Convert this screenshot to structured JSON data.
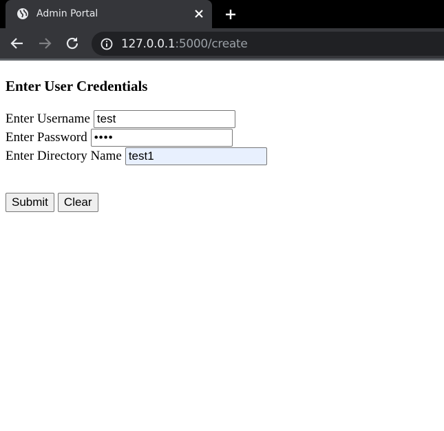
{
  "browser": {
    "tab_title": "Admin Portal",
    "url_host": "127.0.0.1",
    "url_path": ":5000/create",
    "theme": {
      "frame": "#000000",
      "toolbar": "#35363a",
      "omnibox": "#202124"
    }
  },
  "form": {
    "heading": "Enter User Credentials",
    "username_label": "Enter Username",
    "username_value": "test",
    "password_label": "Enter Password",
    "password_value": "test",
    "directory_label": "Enter Directory Name",
    "directory_value": "test1",
    "submit_label": "Submit",
    "clear_label": "Clear"
  }
}
